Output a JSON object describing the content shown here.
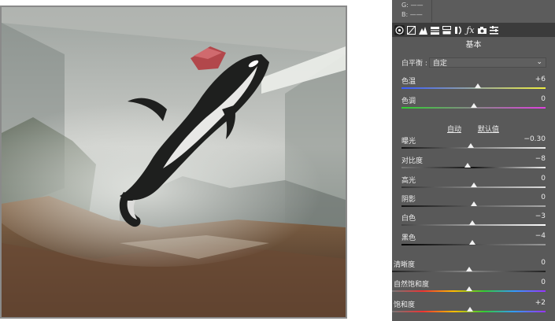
{
  "panel": {
    "rgb": {
      "g_label": "G:",
      "g_value": "——",
      "b_label": "B:",
      "b_value": "——"
    },
    "toolbar": {
      "icons": [
        "basic-icon",
        "tone-curve-icon",
        "detail-icon",
        "hsl-icon",
        "split-toning-icon",
        "lens-icon",
        "fx-icon",
        "camera-icon",
        "presets-icon"
      ]
    },
    "section_title": "基本",
    "white_balance": {
      "label": "白平衡 :",
      "value": "自定",
      "chevron": "⌄"
    },
    "auto_label": "自动",
    "default_label": "默认值",
    "sliders": [
      {
        "label": "色温",
        "value": "+6",
        "level": 0.53
      },
      {
        "label": "色调",
        "value": "0",
        "level": 0.5
      },
      {
        "label": "曝光",
        "value": "−0.30",
        "level": 0.48
      },
      {
        "label": "对比度",
        "value": "−8",
        "level": 0.46
      },
      {
        "label": "高光",
        "value": "0",
        "level": 0.5
      },
      {
        "label": "阴影",
        "value": "0",
        "level": 0.5
      },
      {
        "label": "白色",
        "value": "−3",
        "level": 0.49
      },
      {
        "label": "黑色",
        "value": "−4",
        "level": 0.49
      },
      {
        "label": "清晰度",
        "value": "0",
        "level": 0.5
      },
      {
        "label": "自然饱和度",
        "value": "0",
        "level": 0.5
      },
      {
        "label": "饱和度",
        "value": "+2",
        "level": 0.51
      }
    ]
  },
  "colors": {
    "panel_bg": "#595959",
    "toolbar_bg": "#3b3b3b",
    "temp_gradient": [
      "#3a5cff",
      "#f0f040"
    ],
    "tint_gradient": [
      "#30d030",
      "#e040e0"
    ]
  }
}
